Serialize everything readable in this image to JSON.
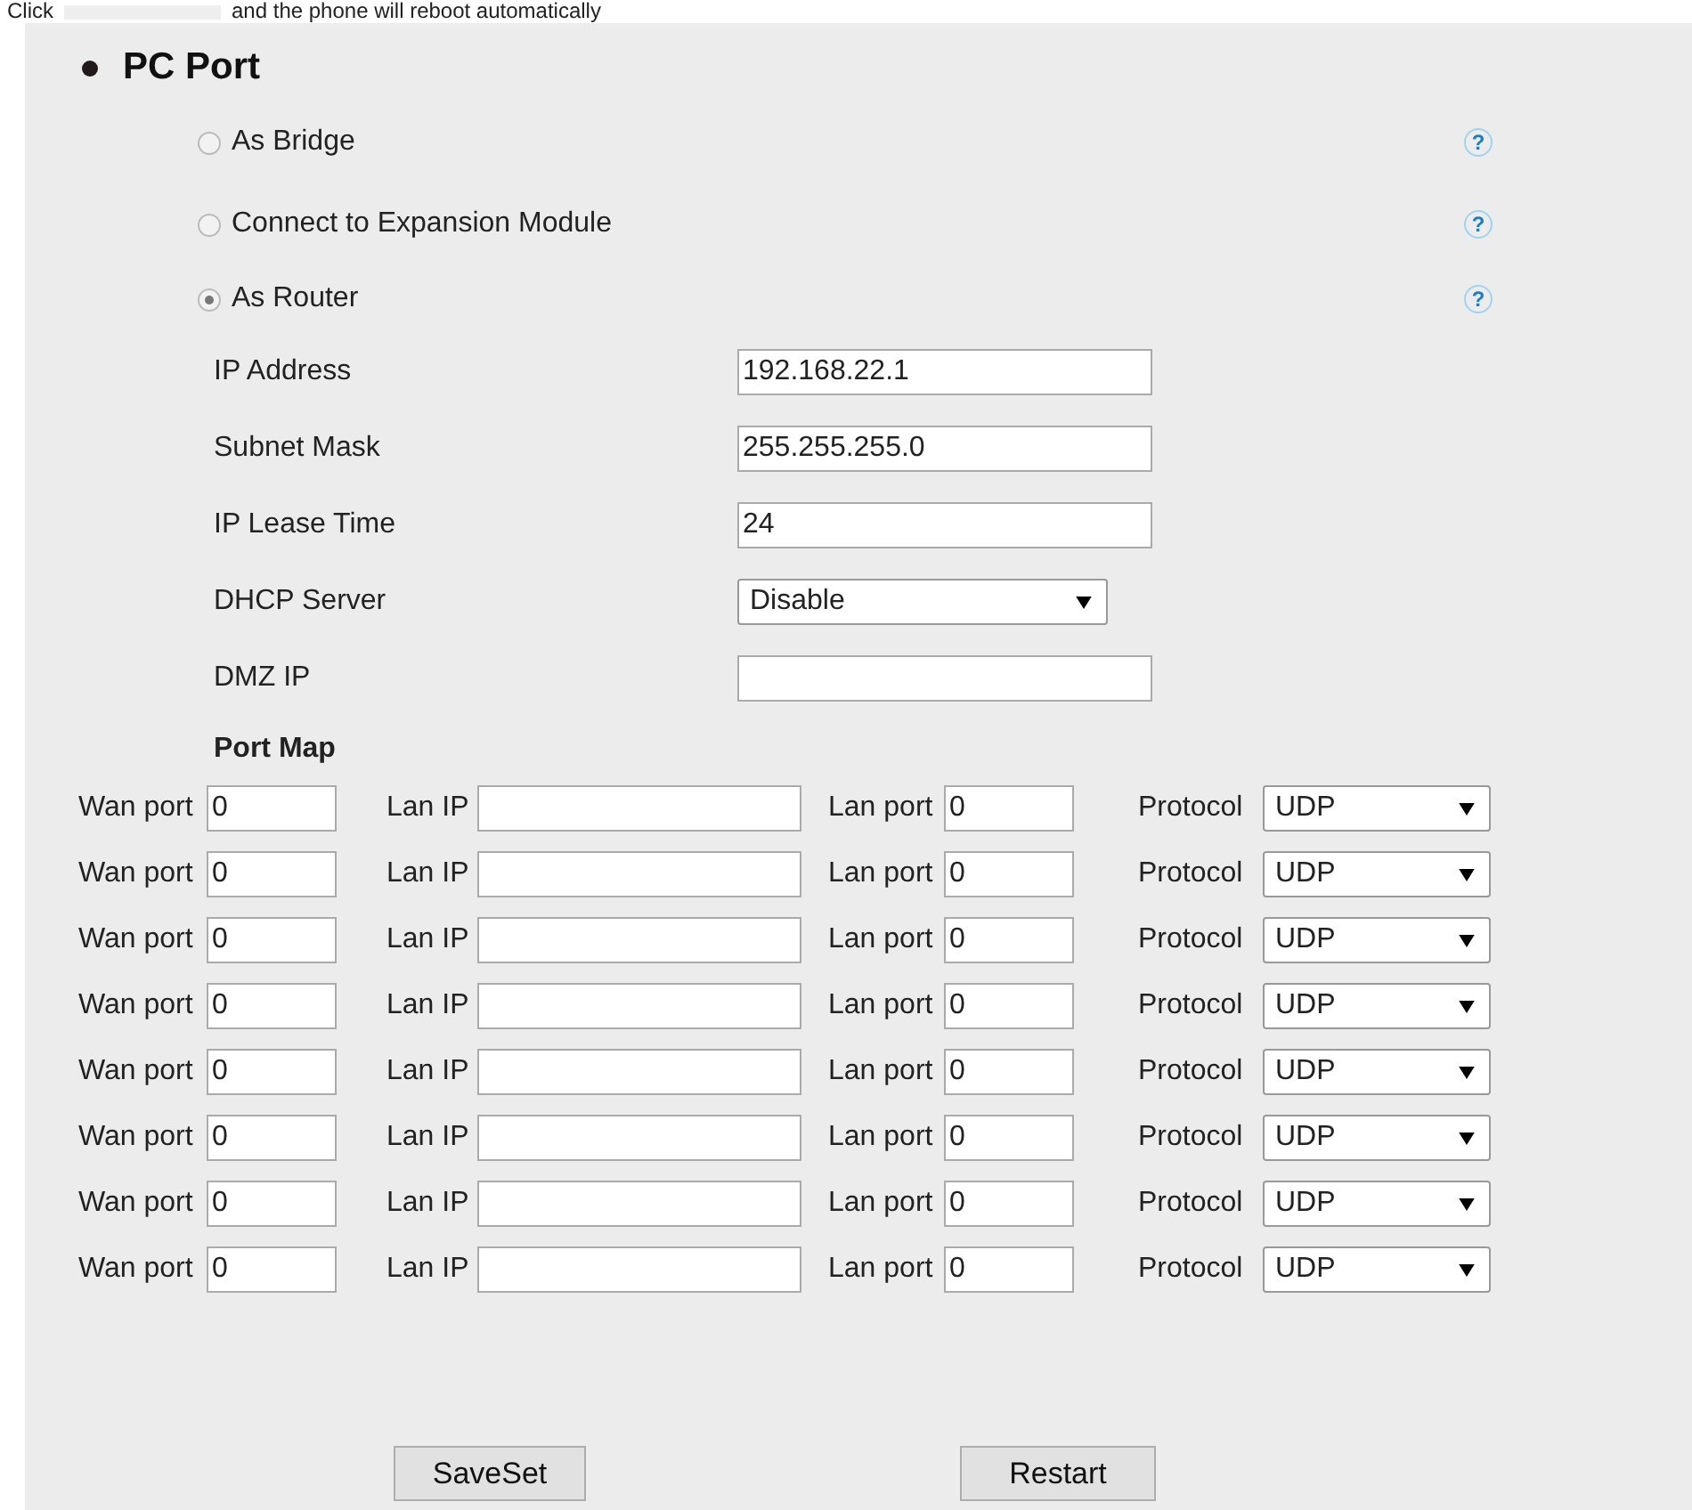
{
  "notice": {
    "before": "Click",
    "after": "and the phone will reboot automatically"
  },
  "section": {
    "title": "PC Port"
  },
  "modes": [
    {
      "label": "As Bridge",
      "selected": false,
      "help": "?"
    },
    {
      "label": "Connect to Expansion Module",
      "selected": false,
      "help": "?"
    },
    {
      "label": "As Router",
      "selected": true,
      "help": "?"
    }
  ],
  "fields": [
    {
      "label": "IP Address",
      "kind": "text",
      "value": "192.168.22.1"
    },
    {
      "label": "Subnet Mask",
      "kind": "text",
      "value": "255.255.255.0"
    },
    {
      "label": "IP Lease Time",
      "kind": "text",
      "value": "24"
    },
    {
      "label": "DHCP Server",
      "kind": "select",
      "value": "Disable"
    },
    {
      "label": "DMZ IP",
      "kind": "text"
    }
  ],
  "port_map": {
    "title": "Port Map",
    "rows": [
      {
        "wan_label": "Wan port",
        "wan_port": "0",
        "lan_ip_label": "Lan IP",
        "lan_port_label": "Lan port",
        "lan_port": "0",
        "protocol_label": "Protocol",
        "protocol": "UDP"
      },
      {
        "wan_label": "Wan port",
        "wan_port": "0",
        "lan_ip_label": "Lan IP",
        "lan_port_label": "Lan port",
        "lan_port": "0",
        "protocol_label": "Protocol",
        "protocol": "UDP"
      },
      {
        "wan_label": "Wan port",
        "wan_port": "0",
        "lan_ip_label": "Lan IP",
        "lan_port_label": "Lan port",
        "lan_port": "0",
        "protocol_label": "Protocol",
        "protocol": "UDP"
      },
      {
        "wan_label": "Wan port",
        "wan_port": "0",
        "lan_ip_label": "Lan IP",
        "lan_port_label": "Lan port",
        "lan_port": "0",
        "protocol_label": "Protocol",
        "protocol": "UDP"
      },
      {
        "wan_label": "Wan port",
        "wan_port": "0",
        "lan_ip_label": "Lan IP",
        "lan_port_label": "Lan port",
        "lan_port": "0",
        "protocol_label": "Protocol",
        "protocol": "UDP"
      },
      {
        "wan_label": "Wan port",
        "wan_port": "0",
        "lan_ip_label": "Lan IP",
        "lan_port_label": "Lan port",
        "lan_port": "0",
        "protocol_label": "Protocol",
        "protocol": "UDP"
      },
      {
        "wan_label": "Wan port",
        "wan_port": "0",
        "lan_ip_label": "Lan IP",
        "lan_port_label": "Lan port",
        "lan_port": "0",
        "protocol_label": "Protocol",
        "protocol": "UDP"
      },
      {
        "wan_label": "Wan port",
        "wan_port": "0",
        "lan_ip_label": "Lan IP",
        "lan_port_label": "Lan port",
        "lan_port": "0",
        "protocol_label": "Protocol",
        "protocol": "UDP"
      }
    ]
  },
  "buttons": [
    "SaveSet",
    "Restart"
  ]
}
